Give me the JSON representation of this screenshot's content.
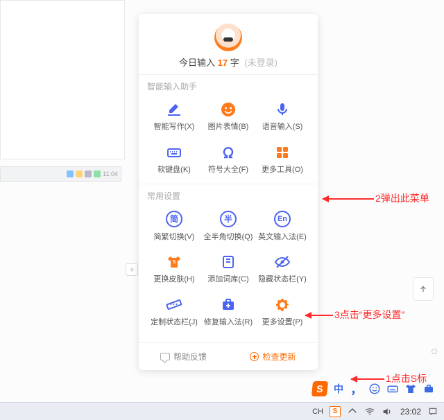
{
  "header": {
    "prefix": "今日输入",
    "count": "17",
    "suffix": "字",
    "not_logged": "(未登录)"
  },
  "sections": {
    "smart": {
      "title": "智能输入助手"
    },
    "common": {
      "title": "常用设置"
    }
  },
  "items": {
    "write": "智能写作(X)",
    "emoji": "图片表情(B)",
    "voice": "语音输入(S)",
    "softkb": "软键盘(K)",
    "symbols": "符号大全(F)",
    "tools": "更多工具(O)",
    "simp": "简繁切换(V)",
    "half": "全半角切换(Q)",
    "eng": "英文输入法(E)",
    "skin": "更换皮肤(H)",
    "dict": "添加词库(C)",
    "hidebar": "隐藏状态栏(Y)",
    "custom": "定制状态栏(J)",
    "repair": "修复输入法(R)",
    "more": "更多设置(P)"
  },
  "badges": {
    "simp": "简",
    "half": "半",
    "eng": "En"
  },
  "footer": {
    "feedback": "帮助反馈",
    "update": "检查更新"
  },
  "annotations": {
    "a1": "1点击S标",
    "a2": "2弹出此菜单",
    "a3": "3点击“更多设置”"
  },
  "imebar": {
    "logo": "S",
    "zhong": "中",
    "comma": "，"
  },
  "taskbar": {
    "ch": "CH",
    "s": "S",
    "time": "23:02"
  }
}
